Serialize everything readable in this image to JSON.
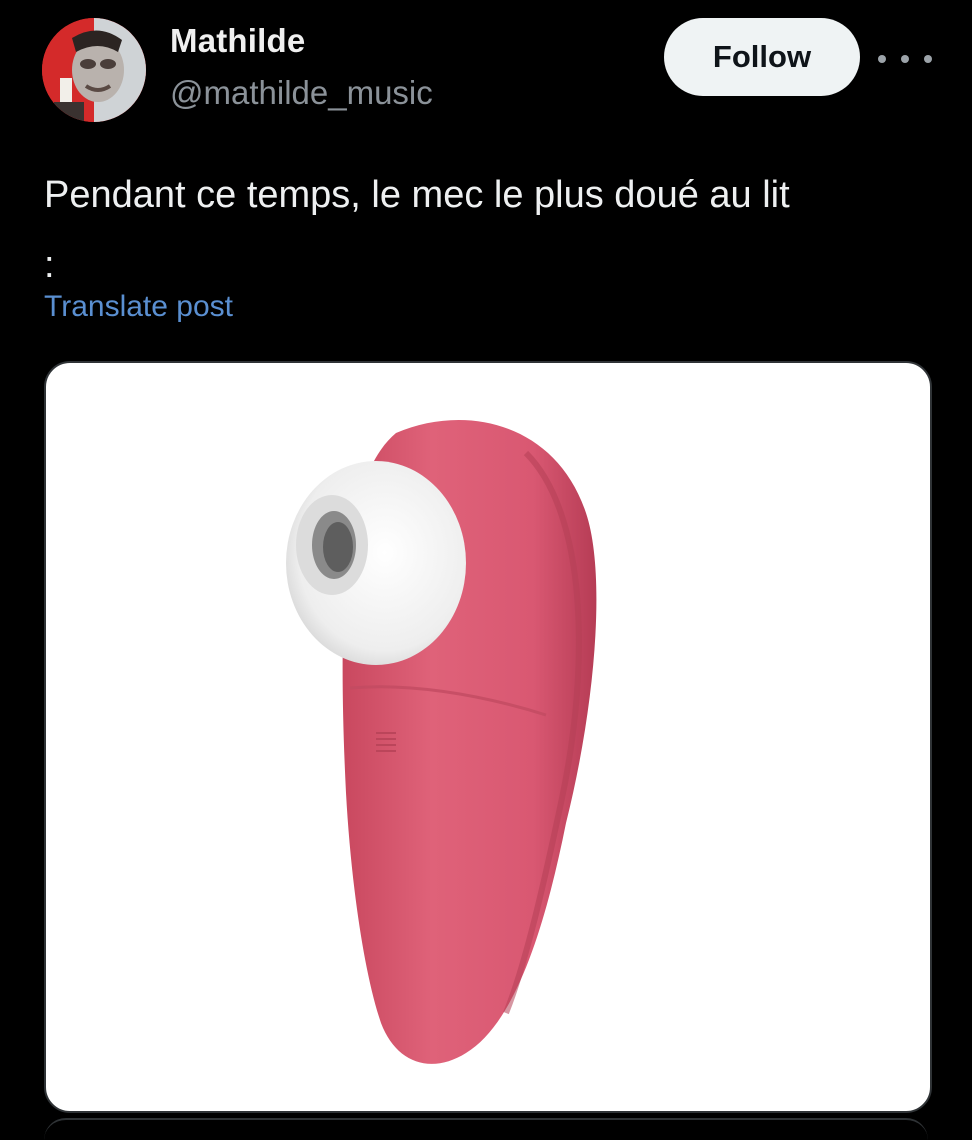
{
  "post": {
    "author": {
      "display_name": "Mathilde",
      "handle": "@mathilde_music"
    },
    "follow_label": "Follow",
    "more_icon": "more-horizontal-icon",
    "text": "Pendant ce temps, le mec le plus doué au lit\n:",
    "translate_label": "Translate post",
    "media": {
      "kind": "product-photo"
    }
  },
  "colors": {
    "background": "#000000",
    "text": "#e7e9ea",
    "secondary_text": "#8b9299",
    "link": "#5a8fd1",
    "follow_button_bg": "#eff3f4",
    "media_background": "#ffffff",
    "product_pink": "#db5a72"
  }
}
